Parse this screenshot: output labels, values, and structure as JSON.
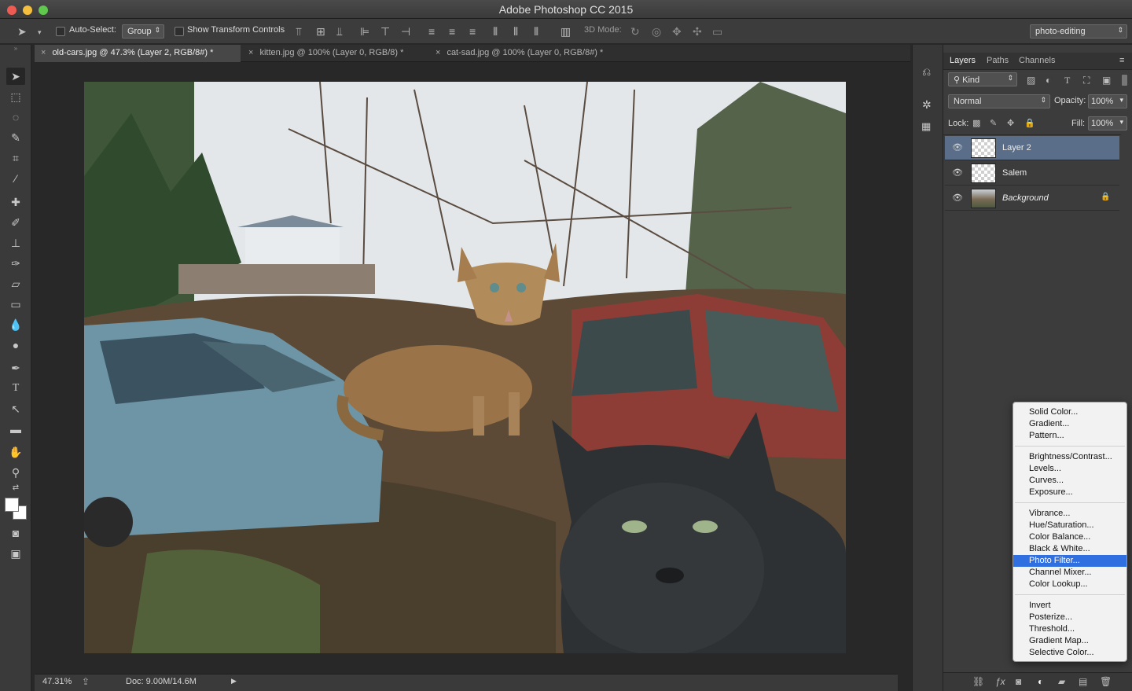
{
  "window": {
    "title": "Adobe Photoshop CC 2015"
  },
  "options_bar": {
    "auto_select_label": "Auto-Select:",
    "auto_select_value": "Group",
    "show_transform_label": "Show Transform Controls",
    "mode_3d_label": "3D Mode:",
    "workspace": "photo-editing"
  },
  "tabs": [
    {
      "label": "old-cars.jpg @ 47.3% (Layer 2, RGB/8#) *",
      "active": true
    },
    {
      "label": "kitten.jpg @ 100% (Layer 0, RGB/8) *",
      "active": false
    },
    {
      "label": "cat-sad.jpg @ 100% (Layer 0, RGB/8#) *",
      "active": false
    }
  ],
  "status": {
    "zoom": "47.31%",
    "doc": "Doc: 9.00M/14.6M"
  },
  "layers_panel": {
    "tabs": [
      "Layers",
      "Paths",
      "Channels"
    ],
    "filter_kind": "Kind",
    "blend_mode": "Normal",
    "opacity_label": "Opacity:",
    "opacity_value": "100%",
    "lock_label": "Lock:",
    "fill_label": "Fill:",
    "fill_value": "100%",
    "layers": [
      {
        "name": "Layer 2",
        "selected": true,
        "locked": false
      },
      {
        "name": "Salem",
        "selected": false,
        "locked": false
      },
      {
        "name": "Background",
        "selected": false,
        "locked": true
      }
    ]
  },
  "adjustment_menu": {
    "groups": [
      [
        "Solid Color...",
        "Gradient...",
        "Pattern..."
      ],
      [
        "Brightness/Contrast...",
        "Levels...",
        "Curves...",
        "Exposure..."
      ],
      [
        "Vibrance...",
        "Hue/Saturation...",
        "Color Balance...",
        "Black & White...",
        "Photo Filter...",
        "Channel Mixer...",
        "Color Lookup..."
      ],
      [
        "Invert",
        "Posterize...",
        "Threshold...",
        "Gradient Map...",
        "Selective Color..."
      ]
    ],
    "highlighted": "Photo Filter..."
  },
  "colors": {
    "selection_highlight": "#2f6fe0",
    "active_layer": "#5a6e8a"
  }
}
